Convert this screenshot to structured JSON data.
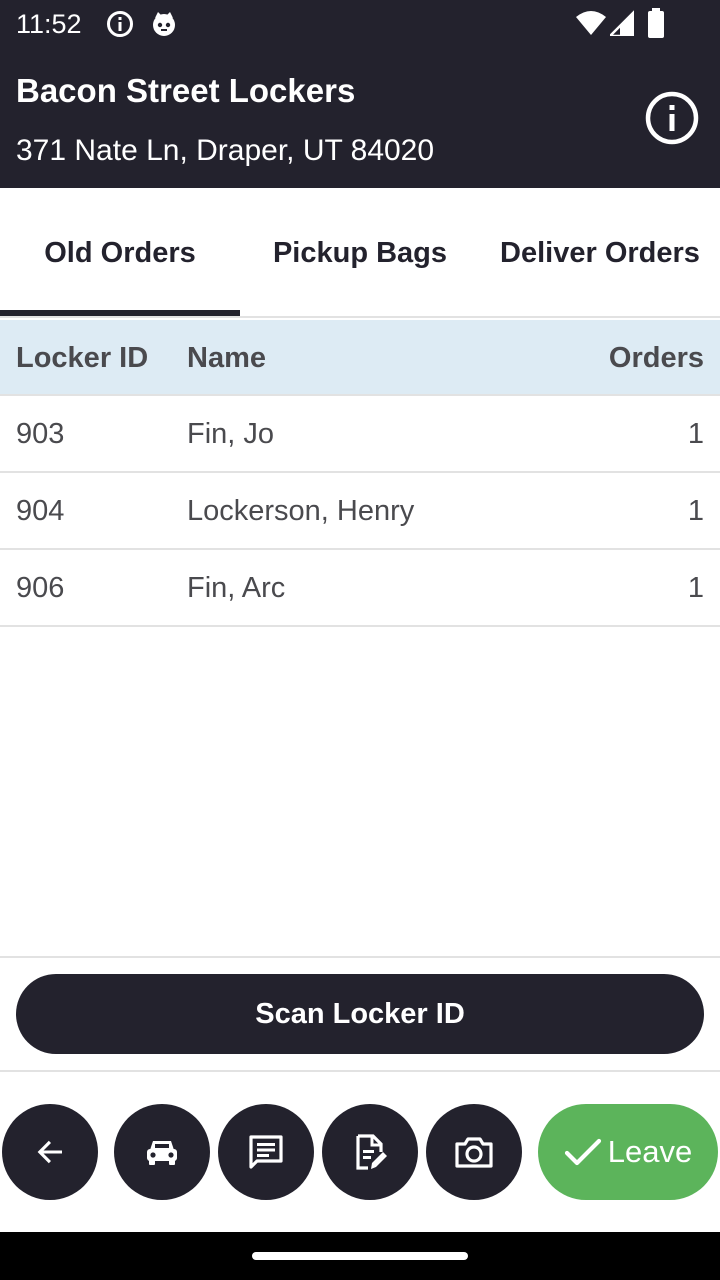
{
  "status_bar": {
    "time": "11:52",
    "icons": [
      "info-icon",
      "cat-icon",
      "wifi-icon",
      "signal-icon",
      "battery-icon"
    ]
  },
  "header": {
    "title": "Bacon Street Lockers",
    "address": "371 Nate Ln, Draper, UT 84020",
    "info_icon": "info-icon"
  },
  "tabs": [
    {
      "label": "Old Orders",
      "active": true
    },
    {
      "label": "Pickup Bags",
      "active": false
    },
    {
      "label": "Deliver Orders",
      "active": false
    }
  ],
  "table": {
    "columns": [
      "Locker ID",
      "Name",
      "Orders"
    ],
    "rows": [
      {
        "locker_id": "903",
        "name": "Fin, Jo",
        "orders": "1"
      },
      {
        "locker_id": "904",
        "name": "Lockerson, Henry",
        "orders": "1"
      },
      {
        "locker_id": "906",
        "name": "Fin, Arc",
        "orders": "1"
      }
    ]
  },
  "scan_button": {
    "label": "Scan Locker ID"
  },
  "actions": {
    "icons": [
      "back-arrow-icon",
      "car-icon",
      "message-icon",
      "edit-note-icon",
      "camera-icon"
    ],
    "leave_label": "Leave",
    "leave_icon": "check-icon"
  },
  "colors": {
    "dark": "#23222d",
    "header_row": "#ddebf4",
    "leave_green": "#5cb45b"
  }
}
